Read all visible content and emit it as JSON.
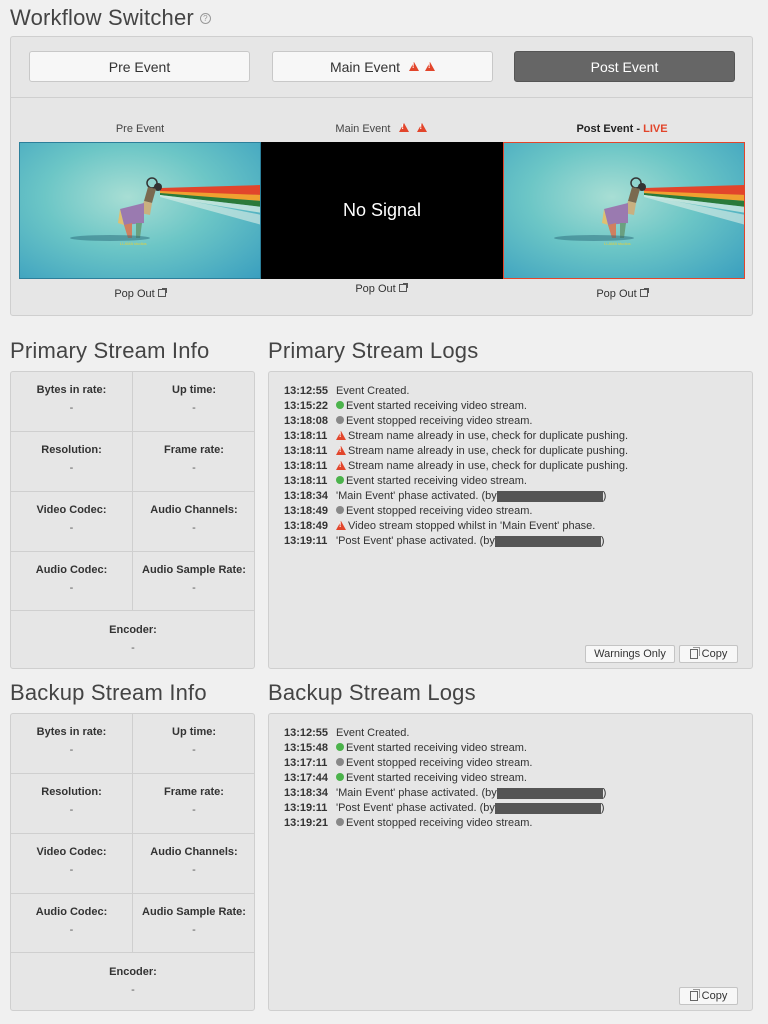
{
  "workflow": {
    "title": "Workflow Switcher",
    "buttons": [
      {
        "label": "Pre Event",
        "warnings": 0,
        "active": false
      },
      {
        "label": "Main Event",
        "warnings": 2,
        "active": false
      },
      {
        "label": "Post Event",
        "warnings": 0,
        "active": true
      }
    ],
    "previews": [
      {
        "label": "Pre Event",
        "warnings": 0,
        "live": false,
        "signal": true,
        "popout": "Pop Out"
      },
      {
        "label": "Main Event",
        "warnings": 2,
        "live": false,
        "signal": false,
        "no_signal_text": "No Signal",
        "popout": "Pop Out"
      },
      {
        "label": "Post Event",
        "live_suffix": "LIVE",
        "live": true,
        "signal": true,
        "popout": "Pop Out"
      }
    ]
  },
  "primary_info": {
    "title": "Primary Stream Info",
    "fields": [
      {
        "label": "Bytes in rate:",
        "value": "-"
      },
      {
        "label": "Up time:",
        "value": "-"
      },
      {
        "label": "Resolution:",
        "value": "-"
      },
      {
        "label": "Frame rate:",
        "value": "-"
      },
      {
        "label": "Video Codec:",
        "value": "-"
      },
      {
        "label": "Audio Channels:",
        "value": "-"
      },
      {
        "label": "Audio Codec:",
        "value": "-"
      },
      {
        "label": "Audio Sample Rate:",
        "value": "-"
      },
      {
        "label": "Encoder:",
        "value": "-"
      }
    ]
  },
  "primary_logs": {
    "title": "Primary Stream Logs",
    "rows": [
      {
        "time": "13:12:55",
        "icon": "none",
        "text": "Event Created."
      },
      {
        "time": "13:15:22",
        "icon": "green-dot-icon",
        "text": "Event started receiving video stream."
      },
      {
        "time": "13:18:08",
        "icon": "grey-dot-icon",
        "text": "Event stopped receiving video stream."
      },
      {
        "time": "13:18:11",
        "icon": "warning-icon",
        "text": "Stream name already in use, check for duplicate pushing."
      },
      {
        "time": "13:18:11",
        "icon": "warning-icon",
        "text": "Stream name already in use, check for duplicate pushing."
      },
      {
        "time": "13:18:11",
        "icon": "warning-icon",
        "text": "Stream name already in use, check for duplicate pushing."
      },
      {
        "time": "13:18:11",
        "icon": "green-dot-icon",
        "text": "Event started receiving video stream."
      },
      {
        "time": "13:18:34",
        "icon": "none",
        "text": "'Main Event' phase activated. (by",
        "redacted": true,
        "suffix": ")"
      },
      {
        "time": "13:18:49",
        "icon": "grey-dot-icon",
        "text": "Event stopped receiving video stream."
      },
      {
        "time": "13:18:49",
        "icon": "warning-icon",
        "text": "Video stream stopped whilst in 'Main Event' phase."
      },
      {
        "time": "13:19:11",
        "icon": "none",
        "text": "'Post Event' phase activated. (by",
        "redacted": true,
        "suffix": ")"
      }
    ],
    "warnings_only_label": "Warnings Only",
    "copy_label": "Copy"
  },
  "backup_info": {
    "title": "Backup Stream Info",
    "fields": [
      {
        "label": "Bytes in rate:",
        "value": "-"
      },
      {
        "label": "Up time:",
        "value": "-"
      },
      {
        "label": "Resolution:",
        "value": "-"
      },
      {
        "label": "Frame rate:",
        "value": "-"
      },
      {
        "label": "Video Codec:",
        "value": "-"
      },
      {
        "label": "Audio Channels:",
        "value": "-"
      },
      {
        "label": "Audio Codec:",
        "value": "-"
      },
      {
        "label": "Audio Sample Rate:",
        "value": "-"
      },
      {
        "label": "Encoder:",
        "value": "-"
      }
    ]
  },
  "backup_logs": {
    "title": "Backup Stream Logs",
    "rows": [
      {
        "time": "13:12:55",
        "icon": "none",
        "text": "Event Created."
      },
      {
        "time": "13:15:48",
        "icon": "green-dot-icon",
        "text": "Event started receiving video stream."
      },
      {
        "time": "13:17:11",
        "icon": "grey-dot-icon",
        "text": "Event stopped receiving video stream."
      },
      {
        "time": "13:17:44",
        "icon": "green-dot-icon",
        "text": "Event started receiving video stream."
      },
      {
        "time": "13:18:34",
        "icon": "none",
        "text": "'Main Event' phase activated. (by",
        "redacted": true,
        "suffix": ")"
      },
      {
        "time": "13:19:11",
        "icon": "none",
        "text": "'Post Event' phase activated. (by",
        "redacted": true,
        "suffix": ")"
      },
      {
        "time": "13:19:21",
        "icon": "grey-dot-icon",
        "text": "Event stopped receiving video stream."
      }
    ],
    "copy_label": "Copy"
  },
  "colors": {
    "warning": "#e2452b",
    "live": "#e2452b",
    "active_button": "#666666",
    "status_green": "#4bb34b",
    "status_grey": "#888888"
  }
}
